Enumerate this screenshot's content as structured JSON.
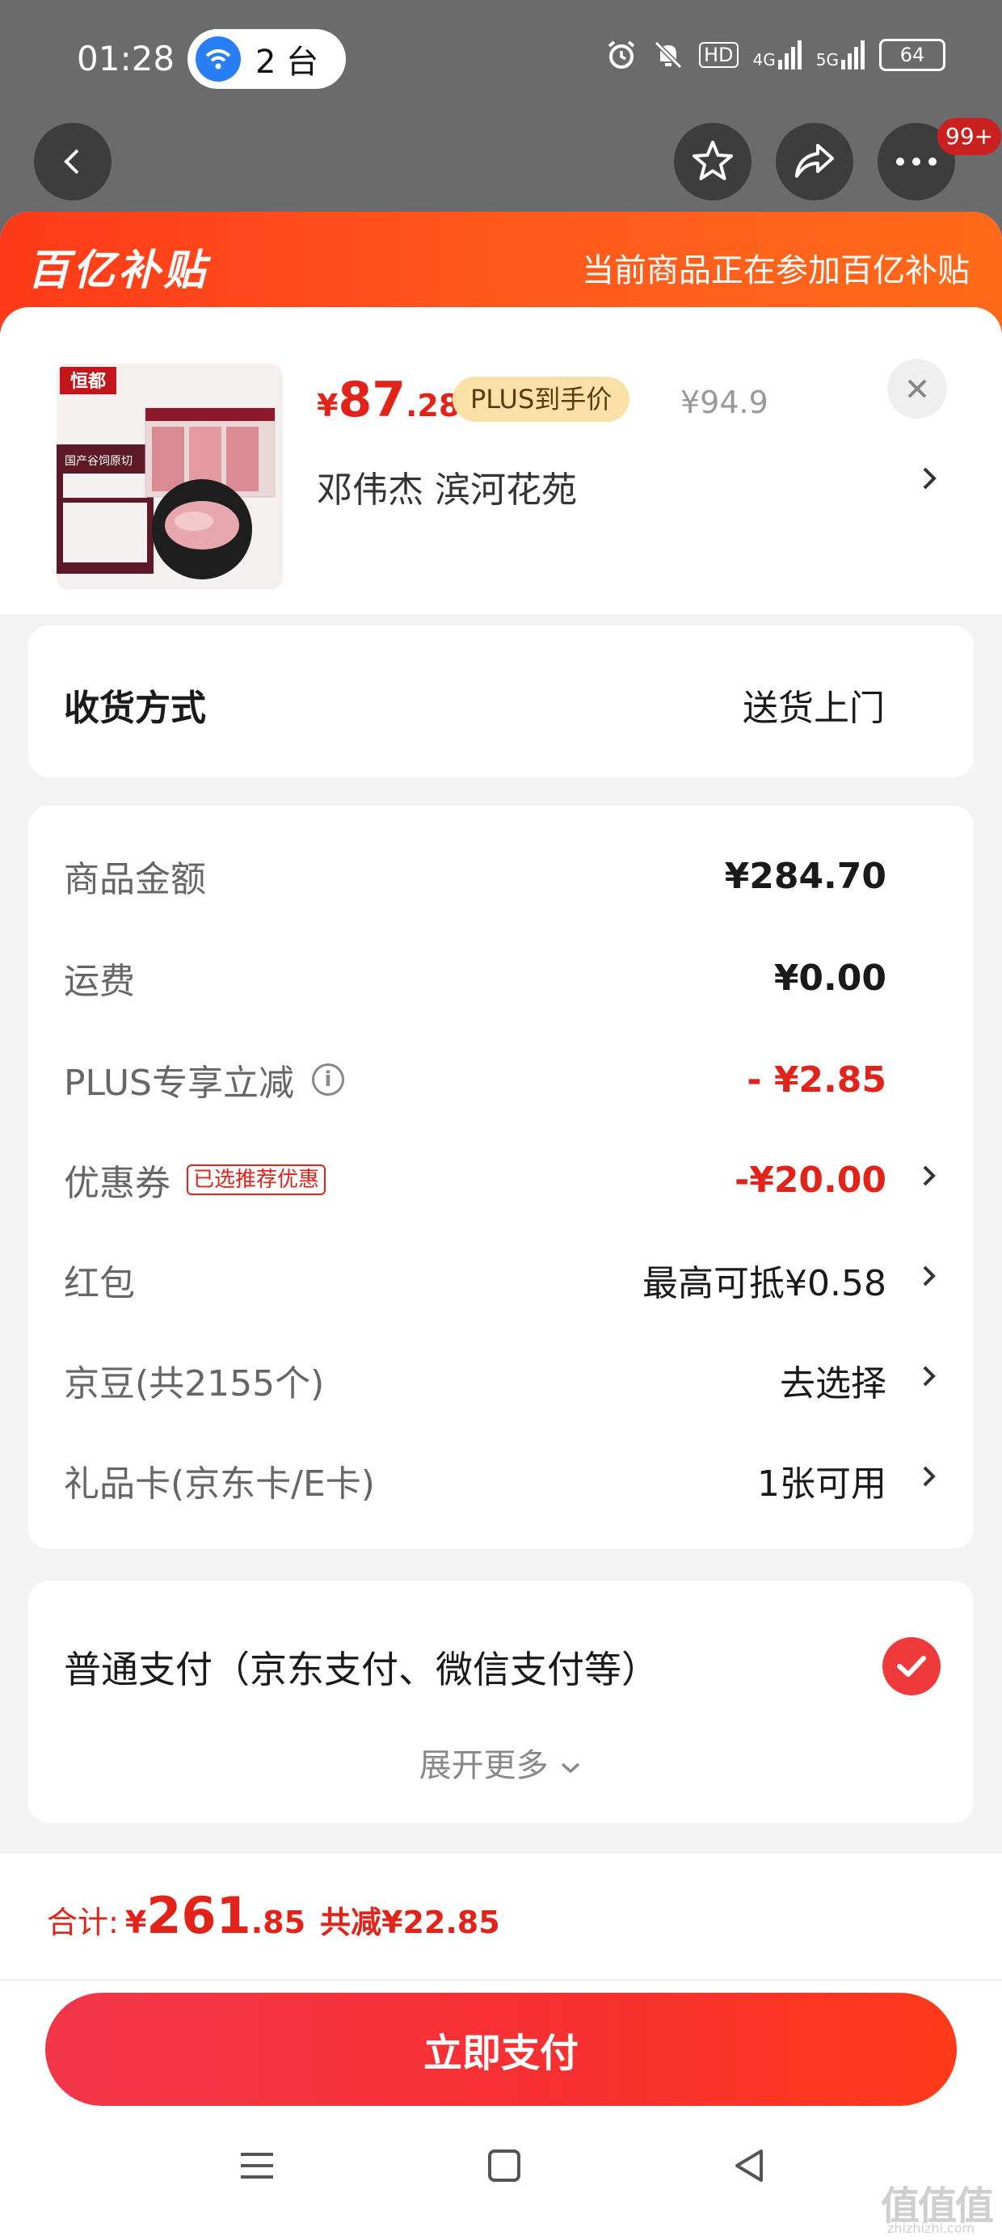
{
  "status_bar": {
    "time": "01:28",
    "hotspot_count": "2 台",
    "network_hd": "HD",
    "network_4g": "4G",
    "network_5g": "5G",
    "battery": "64"
  },
  "topnav": {
    "more_badge": "99+"
  },
  "banner": {
    "logo": "百亿补贴",
    "text": "当前商品正在参加百亿补贴"
  },
  "product": {
    "price_symbol": "¥",
    "price_int": "87",
    "price_dec": ".28",
    "plus_tag": "PLUS到手价",
    "original_price": "¥94.9",
    "address": "邓伟杰  滨河花苑",
    "brand": "恒都",
    "package_title": "国产谷饲原切"
  },
  "delivery": {
    "label": "收货方式",
    "value": "送货上门"
  },
  "fees": [
    {
      "label": "商品金额",
      "value": "¥284.70"
    },
    {
      "label": "运费",
      "value": "¥0.00"
    },
    {
      "label": "PLUS专享立减",
      "value": "- ¥2.85"
    },
    {
      "label": "优惠券",
      "tag": "已选推荐优惠",
      "value": "-¥20.00"
    },
    {
      "label": "红包",
      "value": "最高可抵¥0.58"
    },
    {
      "label": "京豆(共2155个)",
      "value": "去选择"
    },
    {
      "label": "礼品卡(京东卡/E卡)",
      "value": "1张可用"
    }
  ],
  "payment": {
    "method": "普通支付（京东支付、微信支付等）",
    "expand": "展开更多"
  },
  "bottom": {
    "total_label": "合计:",
    "total_symbol": "¥",
    "total_int": "261",
    "total_dec": ".85",
    "saved": "共减¥22.85",
    "pay_button": "立即支付"
  },
  "watermark": {
    "logo": "值值值",
    "url": "zhizhizhi.com"
  },
  "colors": {
    "accent_red": "#e2231a",
    "banner_orange": "#ff4a1a",
    "plus_gold": "#f9e1a8"
  }
}
